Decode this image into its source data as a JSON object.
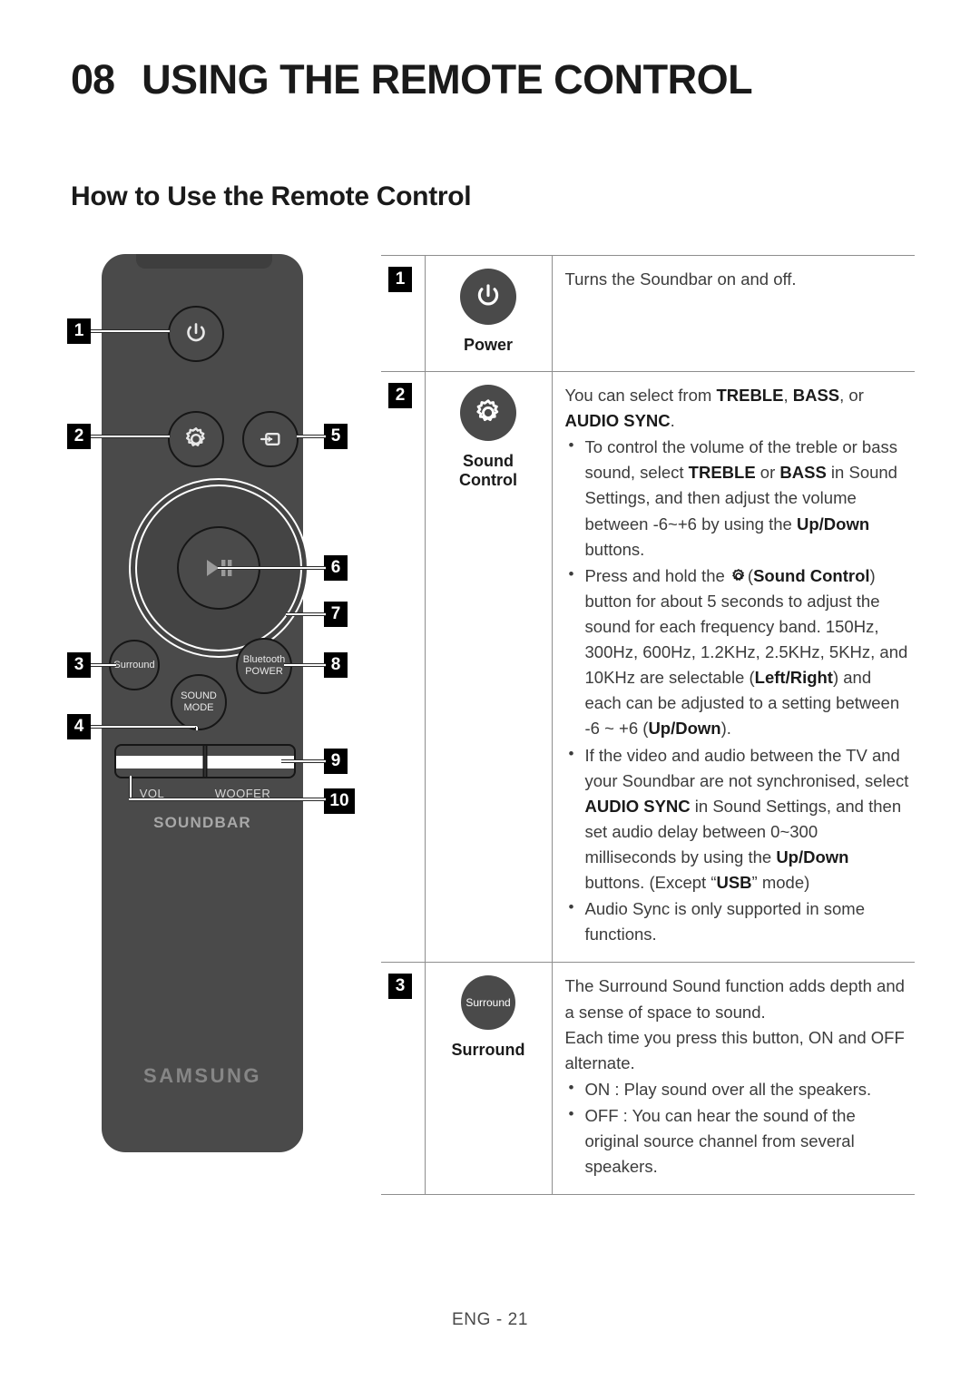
{
  "header": {
    "chapter_number": "08",
    "chapter_title": "USING THE REMOTE CONTROL",
    "section_title": "How to Use the Remote Control"
  },
  "remote": {
    "brand": "SAMSUNG",
    "model_label": "SOUNDBAR",
    "buttons": {
      "surround": "Surround",
      "sound_mode_line1": "SOUND",
      "sound_mode_line2": "MODE",
      "bluetooth_line1": "Bluetooth",
      "bluetooth_line2": "POWER",
      "vol": "VOL",
      "woofer": "WOOFER"
    },
    "callouts": [
      "1",
      "2",
      "3",
      "4",
      "5",
      "6",
      "7",
      "8",
      "9",
      "10"
    ]
  },
  "table": {
    "rows": [
      {
        "number": "1",
        "icon": "power-icon",
        "caption": "Power",
        "description": "Turns the Soundbar on and off."
      },
      {
        "number": "2",
        "icon": "gear-icon",
        "caption": "Sound Control",
        "intro_a": "You can select from ",
        "intro_b1": "TREBLE",
        "intro_c": ", ",
        "intro_b2": "BASS",
        "intro_d": ", or ",
        "intro_b3": "AUDIO SYNC",
        "intro_e": ".",
        "bullets": [
          {
            "p1": "To control the volume of the treble or bass sound, select ",
            "b1": "TREBLE",
            "p2": " or ",
            "b2": "BASS",
            "p3": " in Sound Settings, and then adjust the volume between -6~+6 by using the ",
            "b3": "Up/Down",
            "p4": " buttons."
          },
          {
            "p1": "Press and hold the ",
            "gear": true,
            "p1b": "(",
            "b1": "Sound Control",
            "p2": ") button for about 5 seconds to adjust the sound for each frequency band. 150Hz, 300Hz, 600Hz, 1.2KHz, 2.5KHz, 5KHz, and 10KHz are selectable (",
            "b2": "Left/Right",
            "p3": ") and each can be adjusted to a setting between -6 ~ +6 (",
            "b3": "Up/Down",
            "p4": ")."
          },
          {
            "p1": "If the video and audio between the TV and your Soundbar are not synchronised, select ",
            "b1": "AUDIO SYNC",
            "p2": " in Sound Settings, and then set audio delay between 0~300 milliseconds by using the ",
            "b2": "Up/Down",
            "p3": " buttons. (Except “",
            "b3": "USB",
            "p4": "” mode)"
          },
          {
            "p1": "Audio Sync is only supported in some functions."
          }
        ]
      },
      {
        "number": "3",
        "icon": "surround-icon",
        "icon_text": "Surround",
        "caption": "Surround",
        "para1": "The Surround Sound function adds depth and a sense of space to sound.",
        "para2": "Each time you press this button, ON and OFF alternate.",
        "bullets": [
          {
            "p1": "ON : Play sound over all the speakers."
          },
          {
            "p1": "OFF : You can hear the sound of the original source channel from several speakers."
          }
        ]
      }
    ]
  },
  "footer": {
    "page_label": "ENG - 21"
  },
  "colors": {
    "remote_body": "#4a4a4a",
    "badge_bg": "#000000",
    "table_border": "#8e8e8e",
    "text": "#3c3c3c"
  }
}
